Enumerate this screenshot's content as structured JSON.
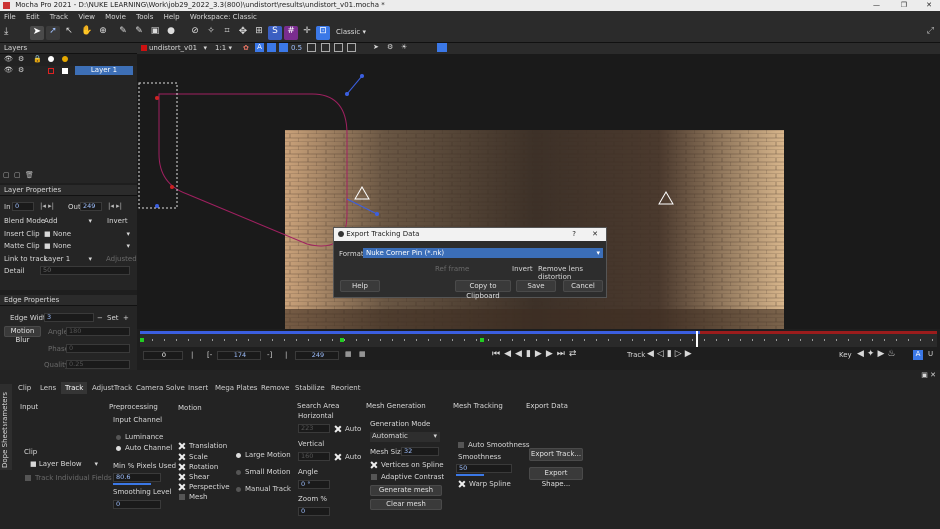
{
  "window": {
    "title": "Mocha Pro 2021 - D:\\NUKE LEARNING\\Work\\job29_2022_3.3(800)\\undistort\\results\\undistort_v01.mocha *"
  },
  "menu": [
    "File",
    "Edit",
    "Track",
    "View",
    "Movie",
    "Tools",
    "Help",
    "Workspace: Classic"
  ],
  "toolbar": {
    "workspace_value": "Classic",
    "clip_name": "undistort_v01",
    "zoom": "1:1",
    "opacity_value": "0.5"
  },
  "layers": {
    "title": "Layers",
    "items": [
      {
        "name": "Layer 1"
      }
    ]
  },
  "layer_properties": {
    "title": "Layer Properties",
    "in_label": "In",
    "in_value": "0",
    "out_label": "Out",
    "out_value": "249",
    "blend_mode_label": "Blend Mode",
    "blend_mode_value": "Add",
    "invert_label": "Invert",
    "insert_clip_label": "Insert Clip",
    "insert_clip_value": "None",
    "matte_clip_label": "Matte Clip",
    "matte_clip_value": "None",
    "link_label": "Link to track",
    "link_value": "Layer 1",
    "adjusted_label": "Adjusted",
    "detail_label": "Detail",
    "detail_value": "50"
  },
  "edge_properties": {
    "title": "Edge Properties",
    "edge_width_label": "Edge Width",
    "edge_width_value": "3",
    "set_label": "Set",
    "motion_blur_label": "Motion Blur",
    "angle_label": "Angle",
    "angle_value": "180",
    "phase_label": "Phase",
    "phase_value": "0",
    "quality_label": "Quality",
    "quality_value": "0.25"
  },
  "dialog": {
    "title": "Export Tracking Data",
    "help_mark": "?",
    "format_label": "Format:",
    "format_value": "Nuke Corner Pin (*.nk)",
    "ref_frame_label": "Ref frame",
    "invert_label": "Invert",
    "remove_lens_label": "Remove lens distortion",
    "help_button": "Help",
    "copy_button": "Copy to Clipboard",
    "save_button": "Save",
    "cancel_button": "Cancel"
  },
  "timeline": {
    "current_frame": "0",
    "in_frame": "174",
    "out_frame": "249",
    "track_label": "Track",
    "key_label": "Key"
  },
  "param_tabs": [
    "Clip",
    "Lens",
    "Track",
    "AdjustTrack",
    "Camera Solve",
    "Insert",
    "Mega Plates",
    "Remove",
    "Stabilize",
    "Reorient"
  ],
  "side_tabs": [
    "Parameters",
    "Dope Sheet"
  ],
  "track_panel": {
    "input_title": "Input",
    "clip_label": "Clip",
    "clip_value": "Layer Below",
    "track_individual": "Track Individual Fields",
    "preprocessing_title": "Preprocessing",
    "input_channel_label": "Input Channel",
    "luminance": "Luminance",
    "auto_channel": "Auto Channel",
    "min_pixels_label": "Min % Pixels Used",
    "min_pixels_value": "80.6",
    "smoothing_label": "Smoothing Level",
    "smoothing_value": "0",
    "motion_title": "Motion",
    "motions": [
      "Translation",
      "Scale",
      "Rotation",
      "Shear",
      "Perspective",
      "Mesh"
    ],
    "large_motion": "Large Motion",
    "small_motion": "Small Motion",
    "manual_track": "Manual Track",
    "search_area_title": "Search Area",
    "horizontal_label": "Horizontal",
    "horizontal_value": "223",
    "auto_label": "Auto",
    "vertical_label": "Vertical",
    "vertical_value": "160",
    "angle_label": "Angle",
    "angle_value": "0 °",
    "zoom_label": "Zoom %",
    "zoom_value": "0",
    "mesh_gen_title": "Mesh Generation",
    "gen_mode_label": "Generation Mode",
    "gen_mode_value": "Automatic",
    "mesh_size_label": "Mesh Size",
    "mesh_size_value": "32",
    "vertices_label": "Vertices on Spline",
    "adaptive_label": "Adaptive Contrast",
    "generate_button": "Generate mesh",
    "clear_button": "Clear mesh",
    "mesh_tracking_title": "Mesh Tracking",
    "auto_smooth_label": "Auto Smoothness",
    "smoothness_label": "Smoothness",
    "smoothness_value": "50",
    "warp_spline_label": "Warp Spline",
    "export_title": "Export Data",
    "export_track_button": "Export Track...",
    "export_shape_button": "Export Shape..."
  },
  "colors": {
    "accent": "#3b78e7",
    "timeline_red": "#9b1c1c",
    "layer_selected": "#3d6fb6"
  }
}
